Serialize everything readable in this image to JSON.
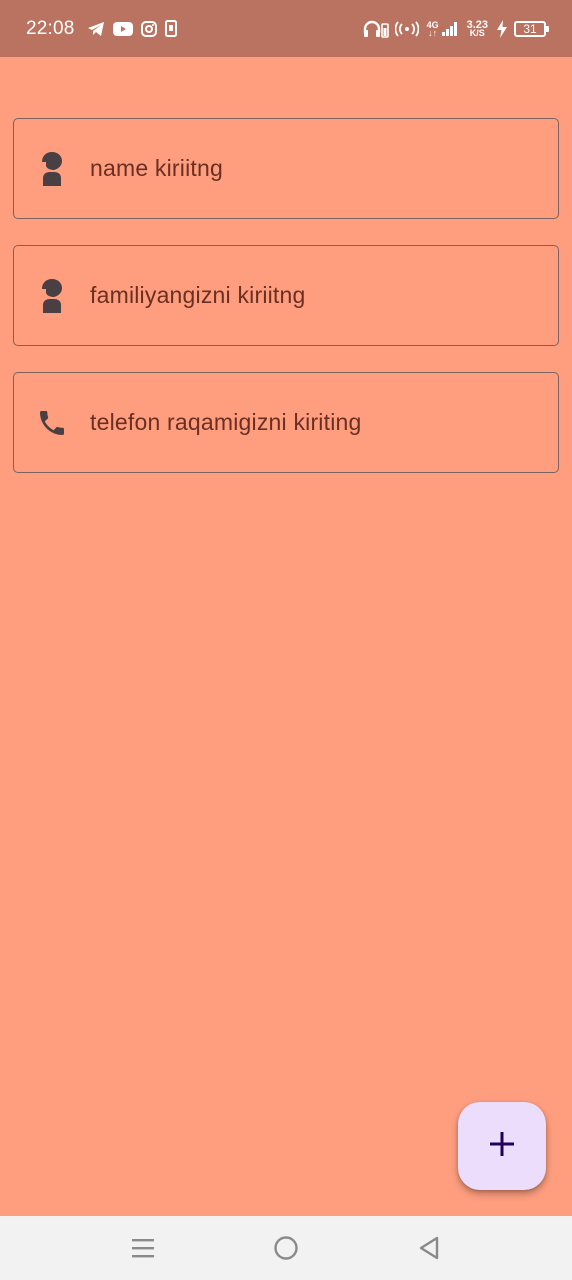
{
  "status_bar": {
    "time": "22:08",
    "network_type_top": "4G",
    "network_speed_value": "3.23",
    "network_speed_unit": "K/S",
    "battery_level": "31",
    "left_icons": [
      "telegram-icon",
      "youtube-icon",
      "instagram-icon",
      "sim-icon"
    ],
    "right_icons": [
      "headphones-battery-icon",
      "hotspot-icon",
      "signal-icon",
      "charging-icon",
      "battery-icon"
    ]
  },
  "form": {
    "fields": [
      {
        "icon": "person-icon",
        "placeholder": "name kiriitng"
      },
      {
        "icon": "person-icon",
        "placeholder": "familiyangizni kiriitng"
      },
      {
        "icon": "phone-icon",
        "placeholder": "telefon raqamigizni kiriting"
      }
    ]
  },
  "fab": {
    "icon": "plus-icon",
    "color": "#EBDDFB"
  },
  "navigation": {
    "buttons": [
      "menu-icon",
      "home-circle-icon",
      "back-triangle-icon"
    ]
  },
  "colors": {
    "background": "#FF9E7F",
    "status_bar": "#BA7361",
    "field_text": "#6A2F22",
    "icon": "#4A4044"
  }
}
